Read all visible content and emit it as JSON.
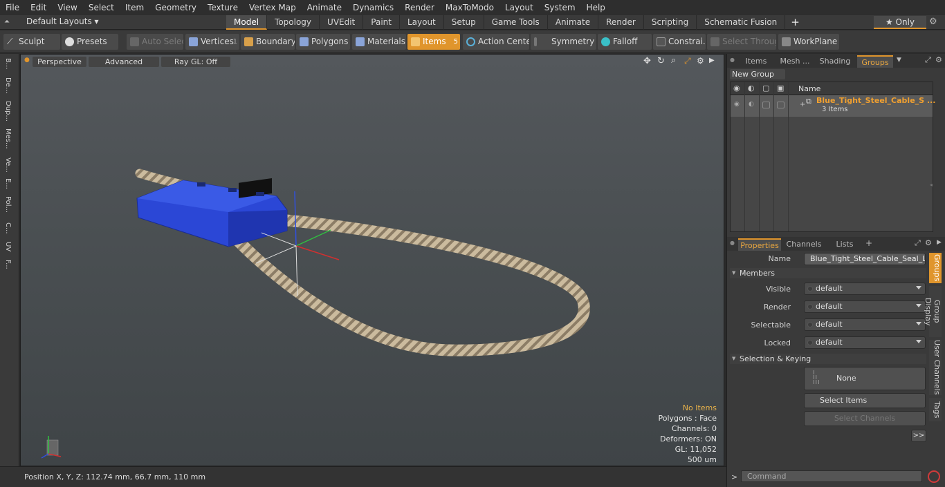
{
  "menu": [
    "File",
    "Edit",
    "View",
    "Select",
    "Item",
    "Geometry",
    "Texture",
    "Vertex Map",
    "Animate",
    "Dynamics",
    "Render",
    "MaxToModo",
    "Layout",
    "System",
    "Help"
  ],
  "layout_selector": "Default Layouts ▾",
  "mode_tabs": [
    "Model",
    "Topology",
    "UVEdit",
    "Paint",
    "Layout",
    "Setup",
    "Game Tools",
    "Animate",
    "Render",
    "Scripting",
    "Schematic Fusion"
  ],
  "mode_tab_plus": "+",
  "only_button": "★  Only",
  "toolbar": {
    "sculpt": "Sculpt",
    "presets": "Presets",
    "auto_select": "Auto Select",
    "vertices": "Vertices",
    "vertices_count": "1",
    "boundary": "Boundary",
    "polygons": "Polygons",
    "materials": "Materials",
    "items": "Items",
    "items_count": "5",
    "action_center": "Action Center",
    "symmetry": "Symmetry",
    "falloff": "Falloff",
    "constraints": "Constrai...",
    "select_through": "Select Through",
    "workplane": "WorkPlane"
  },
  "left_strip": [
    "B...",
    "De...",
    "Dup...",
    "Mes...",
    "Ve...",
    "E...",
    "Pol...",
    "C...",
    "UV",
    "F..."
  ],
  "viewport": {
    "perspective": "Perspective",
    "advanced": "Advanced",
    "raygl": "Ray GL: Off",
    "stats": {
      "no_items": "No Items",
      "polygons": "Polygons : Face",
      "channels": "Channels: 0",
      "deformers": "Deformers: ON",
      "gl": "GL: 11,052",
      "unit": "500 um"
    }
  },
  "status": {
    "position": "Position X, Y, Z:   112.74 mm, 66.7 mm, 110 mm"
  },
  "panel_top": {
    "tabs": [
      "Items",
      "Mesh ...",
      "Shading",
      "Groups"
    ],
    "new_group": "New Group",
    "col_name": "Name",
    "group_name": "Blue_Tight_Steel_Cable_S ...",
    "group_count": "3 Items"
  },
  "panel_bottom": {
    "tabs": [
      "Properties",
      "Channels",
      "Lists"
    ],
    "plus": "+",
    "name_label": "Name",
    "name_value": "Blue_Tight_Steel_Cable_Seal_Loop",
    "members": "Members",
    "visible_label": "Visible",
    "render_label": "Render",
    "selectable_label": "Selectable",
    "locked_label": "Locked",
    "default_value": "default",
    "selection_keying": "Selection & Keying",
    "none": "None",
    "select_items": "Select Items",
    "select_channels": "Select Channels",
    "more": ">>",
    "side_tabs": [
      "Groups",
      "Group Display",
      "User Channels",
      "Tags"
    ]
  },
  "command": {
    "arrow": ">",
    "placeholder": "Command"
  },
  "colors": {
    "accent": "#e0952c",
    "seal_blue": "#2b47d6",
    "cable": "#c8b89c"
  }
}
